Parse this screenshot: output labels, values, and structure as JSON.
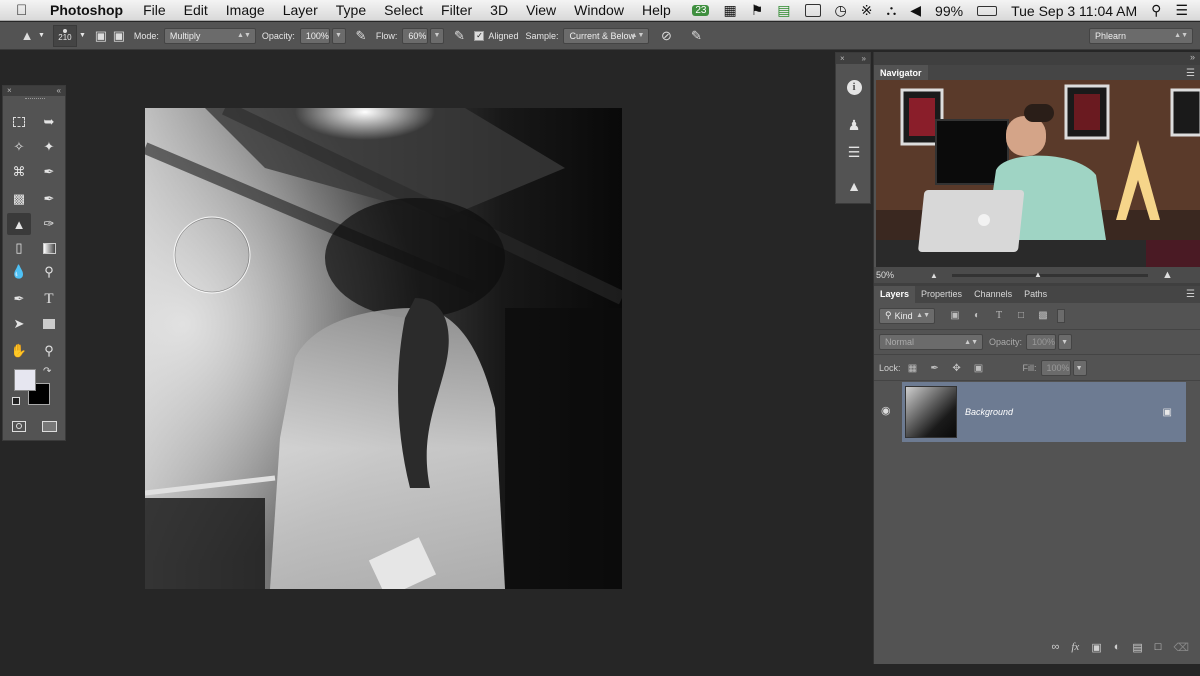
{
  "menubar": {
    "app_name": "Photoshop",
    "items": [
      "File",
      "Edit",
      "Image",
      "Layer",
      "Type",
      "Select",
      "Filter",
      "3D",
      "View",
      "Window",
      "Help"
    ],
    "status_badge": "23",
    "battery": "99%",
    "clock": "Tue Sep 3  11:04 AM"
  },
  "options": {
    "brush_size": "210",
    "mode_label": "Mode:",
    "mode_value": "Multiply",
    "opacity_label": "Opacity:",
    "opacity_value": "100%",
    "flow_label": "Flow:",
    "flow_value": "60%",
    "aligned_label": "Aligned",
    "sample_label": "Sample:",
    "sample_value": "Current & Below",
    "workspace": "Phlearn"
  },
  "navigator": {
    "title": "Navigator",
    "zoom": "50%"
  },
  "layers_panel": {
    "tabs": [
      "Layers",
      "Properties",
      "Channels",
      "Paths"
    ],
    "filter_kind": "Kind",
    "blend_mode": "Normal",
    "opacity_label": "Opacity:",
    "opacity_value": "100%",
    "lock_label": "Lock:",
    "fill_label": "Fill:",
    "fill_value": "100%",
    "layer_name": "Background"
  }
}
